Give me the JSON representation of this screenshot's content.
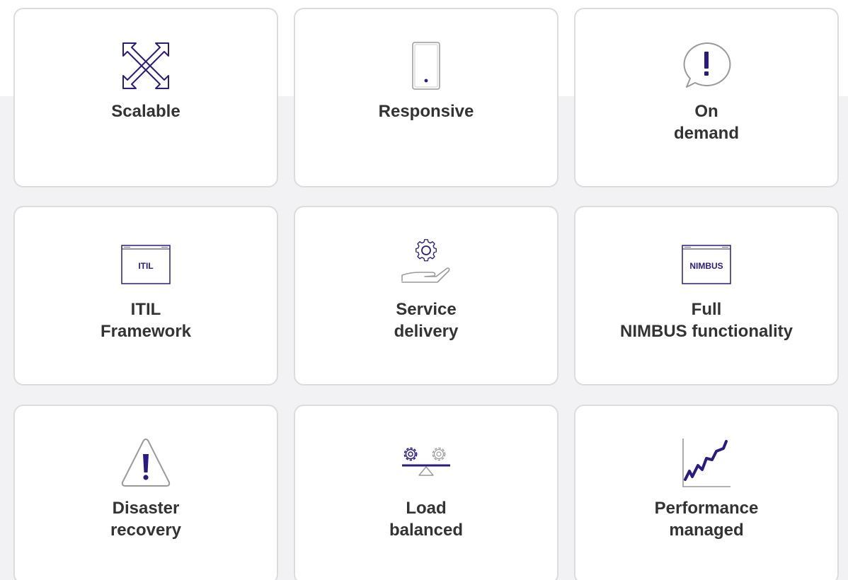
{
  "colors": {
    "accent": "#2b1a86",
    "icon_outline": "#9a9a9a",
    "card_border": "#dcdcdc",
    "label": "#333333",
    "background_band": "#f2f2f4"
  },
  "cards": [
    {
      "label": "Scalable",
      "icon": "expand-arrows-icon"
    },
    {
      "label": "Responsive",
      "icon": "mobile-phone-icon"
    },
    {
      "label": "On\ndemand",
      "icon": "speech-bubble-exclamation-icon"
    },
    {
      "label": "ITIL\nFramework",
      "icon": "itil-window-icon",
      "icon_text": "ITIL"
    },
    {
      "label": "Service\ndelivery",
      "icon": "gear-hand-icon"
    },
    {
      "label": "Full\nNIMBUS functionality",
      "icon": "nimbus-window-icon",
      "icon_text": "NIMBUS"
    },
    {
      "label": "Disaster\nrecovery",
      "icon": "warning-triangle-icon"
    },
    {
      "label": "Load\nbalanced",
      "icon": "balance-gears-icon"
    },
    {
      "label": "Performance\nmanaged",
      "icon": "rising-chart-icon"
    }
  ]
}
